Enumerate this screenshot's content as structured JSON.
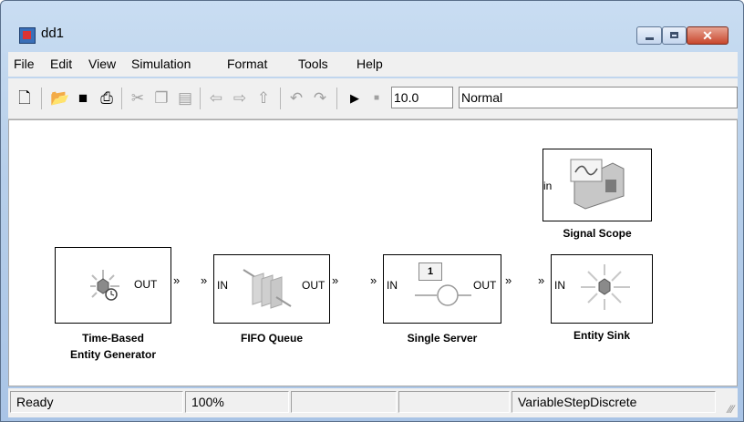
{
  "window": {
    "title": "dd1"
  },
  "menu": [
    "File",
    "Edit",
    "View",
    "Simulation",
    "Format",
    "Tools",
    "Help"
  ],
  "toolbar": {
    "icons": [
      "new-file-icon",
      "open-folder-icon",
      "save-icon",
      "print-icon",
      "cut-icon",
      "copy-icon",
      "paste-icon",
      "back-icon",
      "forward-icon",
      "up-icon",
      "undo-icon",
      "redo-icon",
      "start-simulation-icon",
      "stop-simulation-icon"
    ],
    "stop_time": "10.0",
    "sim_mode": "Normal"
  },
  "blocks": {
    "generator": {
      "label_line1": "Time-Based",
      "label_line2": "Entity Generator",
      "out_port": "OUT"
    },
    "fifo": {
      "label": "FIFO Queue",
      "in_port": "IN",
      "out_port": "OUT"
    },
    "server": {
      "label": "Single Server",
      "in_port": "IN",
      "out_port": "OUT",
      "count": "1"
    },
    "sink": {
      "label": "Entity Sink",
      "in_port": "IN"
    },
    "scope": {
      "label": "Signal Scope",
      "in_port": "in"
    }
  },
  "status": {
    "state": "Ready",
    "zoom": "100%",
    "solver": "VariableStepDiscrete"
  }
}
